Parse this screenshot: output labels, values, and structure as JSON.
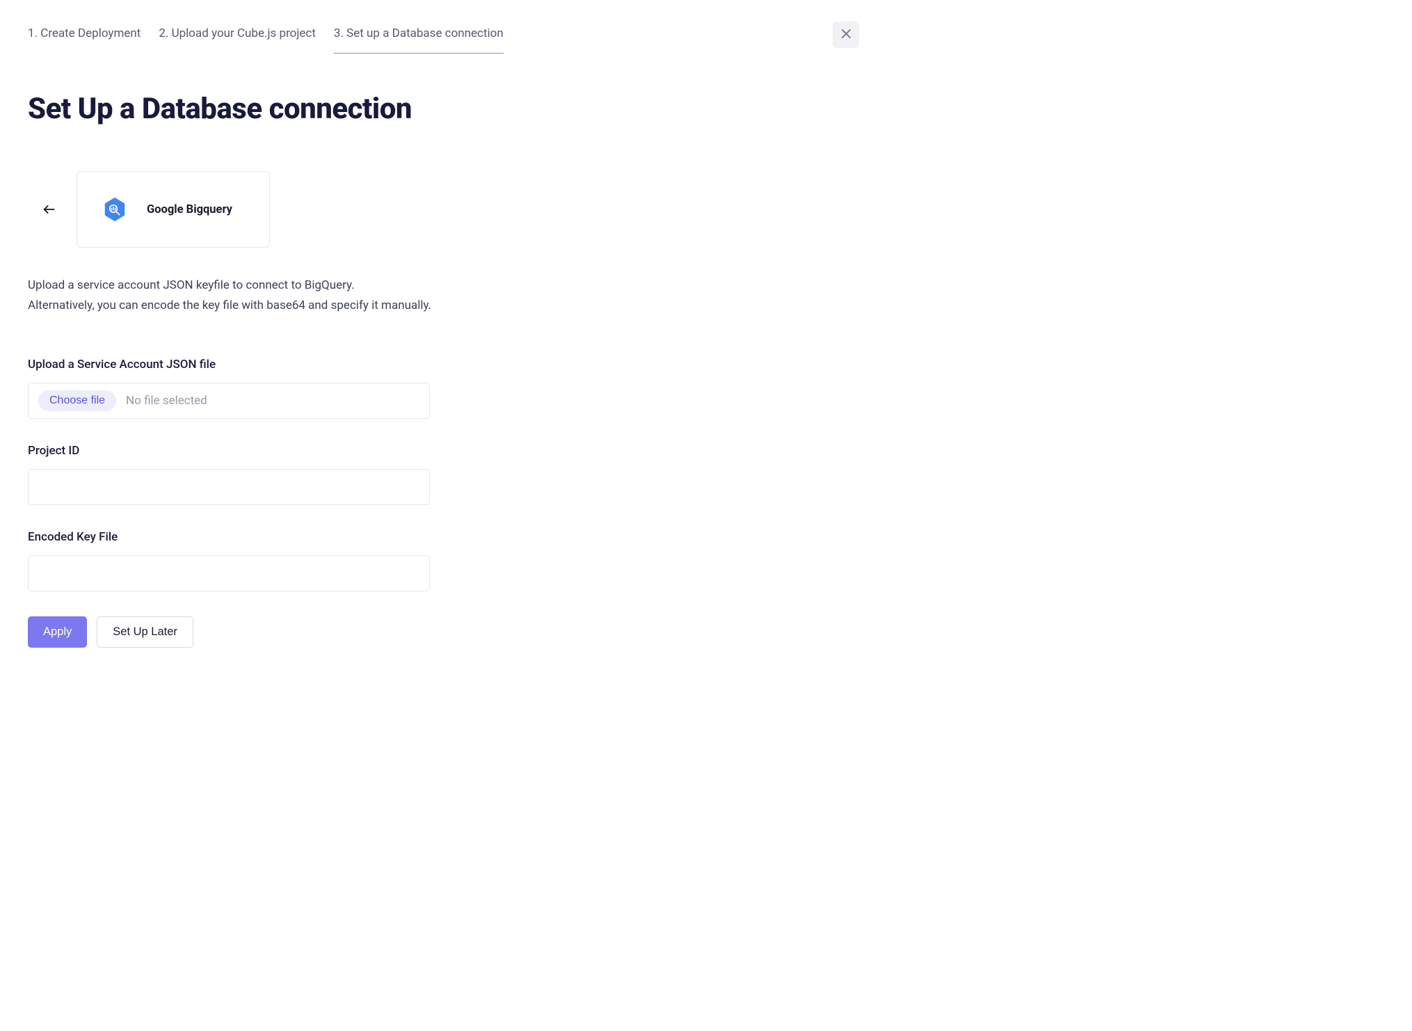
{
  "steps": {
    "step1": "1. Create Deployment",
    "step2": "2. Upload your Cube.js project",
    "step3": "3. Set up a Database connection"
  },
  "page_title": "Set Up a Database connection",
  "database": {
    "name": "Google Bigquery"
  },
  "instructions": {
    "line1": "Upload a service account JSON keyfile to connect to BigQuery.",
    "line2": "Alternatively, you can encode the key file with base64 and specify it manually."
  },
  "form": {
    "upload_label": "Upload a Service Account JSON file",
    "choose_file_label": "Choose file",
    "file_status": "No file selected",
    "project_id_label": "Project ID",
    "project_id_value": "",
    "encoded_key_label": "Encoded Key File",
    "encoded_key_value": ""
  },
  "buttons": {
    "apply": "Apply",
    "setup_later": "Set Up Later"
  }
}
